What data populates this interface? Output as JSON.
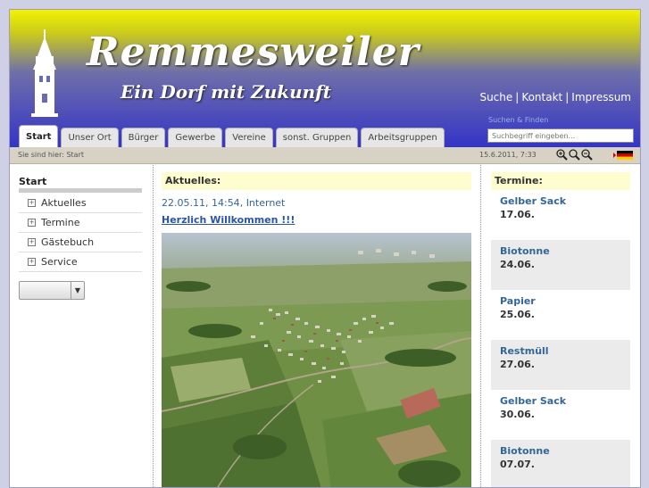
{
  "header": {
    "title": "Remmesweiler",
    "subtitle": "Ein Dorf mit Zukunft",
    "links": [
      "Suche",
      "Kontakt",
      "Impressum"
    ],
    "search_caption": "Suchen & Finden",
    "search_placeholder": "Suchbegriff eingeben..."
  },
  "tabs": [
    "Start",
    "Unser Ort",
    "Bürger",
    "Gewerbe",
    "Vereine",
    "sonst. Gruppen",
    "Arbeitsgruppen"
  ],
  "active_tab": "Start",
  "breadcrumb": "Sie sind hier: Start",
  "datetime": "15.6.2011, 7:33",
  "sidebar": {
    "title": "Start",
    "items": [
      "Aktuelles",
      "Termine",
      "Gästebuch",
      "Service"
    ]
  },
  "news": {
    "heading": "Aktuelles:",
    "date": "22.05.11",
    "time": "14:54",
    "category": "Internet",
    "title": "Herzlich Willkommen !!!"
  },
  "events": {
    "heading": "Termine:",
    "items": [
      {
        "name": "Gelber Sack",
        "date": "17.06."
      },
      {
        "name": "Biotonne",
        "date": "24.06."
      },
      {
        "name": "Papier",
        "date": "25.06."
      },
      {
        "name": "Restmüll",
        "date": "27.06."
      },
      {
        "name": "Gelber Sack",
        "date": "30.06."
      },
      {
        "name": "Biotonne",
        "date": "07.07."
      }
    ]
  },
  "colors": {
    "header_top": "#f2f200",
    "header_bottom": "#3434c8",
    "link": "#336699",
    "section_head_bg": "#fdfdd0"
  }
}
